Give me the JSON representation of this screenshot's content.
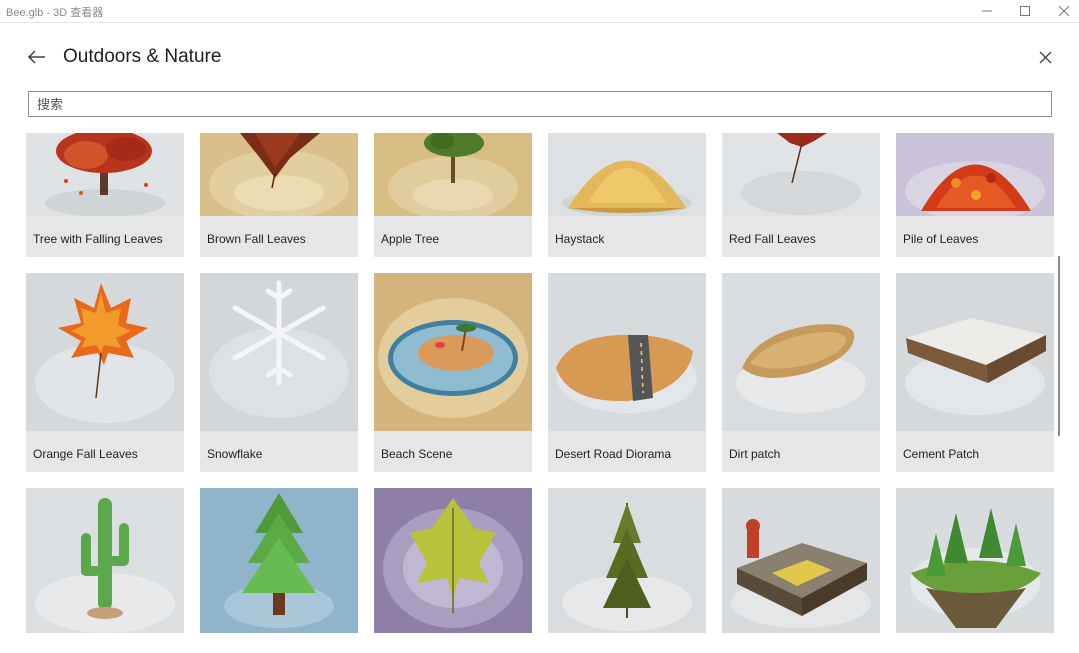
{
  "window": {
    "title": "Bee.glb - 3D 查看器",
    "minimize_icon": "minimize-icon",
    "maximize_icon": "maximize-icon",
    "close_icon": "close-icon"
  },
  "header": {
    "title": "Outdoors & Nature",
    "back_icon": "arrow-left-icon",
    "close_icon": "close-icon"
  },
  "search": {
    "placeholder": "搜索",
    "value": ""
  },
  "items": [
    {
      "label": "Tree with Falling Leaves",
      "icon": "tree-icon"
    },
    {
      "label": "Brown Fall Leaves",
      "icon": "leaf-icon"
    },
    {
      "label": "Apple Tree",
      "icon": "tree-icon"
    },
    {
      "label": "Haystack",
      "icon": "haystack-icon"
    },
    {
      "label": "Red Fall Leaves",
      "icon": "leaf-icon"
    },
    {
      "label": "Pile of Leaves",
      "icon": "leaf-pile-icon"
    },
    {
      "label": "Orange Fall Leaves",
      "icon": "maple-leaf-icon"
    },
    {
      "label": "Snowflake",
      "icon": "snowflake-icon"
    },
    {
      "label": "Beach Scene",
      "icon": "island-icon"
    },
    {
      "label": "Desert Road Diorama",
      "icon": "desert-road-icon"
    },
    {
      "label": "Dirt patch",
      "icon": "dirt-icon"
    },
    {
      "label": "Cement Patch",
      "icon": "cement-icon"
    },
    {
      "label": "",
      "icon": "cactus-icon"
    },
    {
      "label": "",
      "icon": "pine-tree-icon"
    },
    {
      "label": "",
      "icon": "leaf-icon"
    },
    {
      "label": "",
      "icon": "pine-tree-icon"
    },
    {
      "label": "",
      "icon": "hydrant-diorama-icon"
    },
    {
      "label": "",
      "icon": "floating-island-icon"
    }
  ],
  "colors": {
    "card_bg": "#e6e6e6",
    "search_border": "#8c8c8c",
    "scrollbar": "#8a8a8a"
  }
}
